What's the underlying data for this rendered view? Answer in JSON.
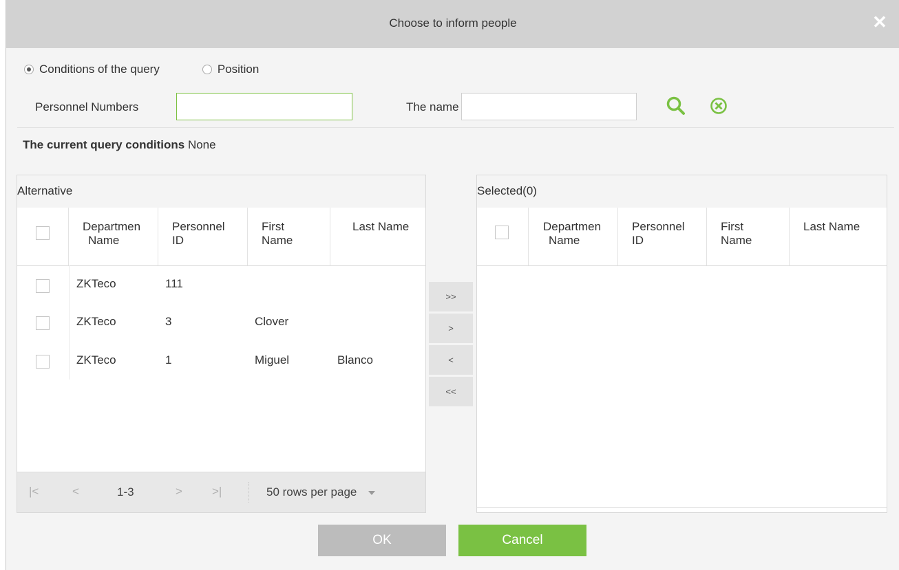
{
  "dialog": {
    "title": "Choose to inform people",
    "close_glyph": "✕"
  },
  "query_mode": {
    "options": [
      {
        "label": "Conditions of the query",
        "checked": true
      },
      {
        "label": "Position",
        "checked": false
      }
    ]
  },
  "search": {
    "personnel_numbers_label": "Personnel Numbers",
    "personnel_numbers_value": "",
    "name_label": "The name",
    "name_value": "",
    "search_icon": "search-icon",
    "clear_icon": "clear-circle-icon",
    "accent_color": "#7ac143"
  },
  "conditions": {
    "label": "The current query conditions",
    "value": "None"
  },
  "alternative": {
    "title": "Alternative",
    "columns": [
      [
        "Departmen",
        "Name"
      ],
      [
        "Personnel",
        "ID"
      ],
      [
        "First",
        "Name"
      ],
      [
        "Last Name"
      ]
    ],
    "rows": [
      {
        "department": "ZKTeco",
        "id": "111",
        "first": "",
        "last": ""
      },
      {
        "department": "ZKTeco",
        "id": "3",
        "first": "Clover",
        "last": ""
      },
      {
        "department": "ZKTeco",
        "id": "1",
        "first": "Miguel",
        "last": "Blanco"
      }
    ],
    "pager": {
      "first": "|<",
      "prev": "<",
      "range": "1-3",
      "next": ">",
      "last": ">|",
      "rows_per_page": "50 rows per page"
    }
  },
  "transfer": {
    "add_all": ">>",
    "add": ">",
    "remove": "<",
    "remove_all": "<<"
  },
  "selected": {
    "title": "Selected(0)",
    "columns": [
      [
        "Departmen",
        "Name"
      ],
      [
        "Personnel",
        "ID"
      ],
      [
        "First",
        "Name"
      ],
      [
        "Last Name"
      ]
    ]
  },
  "buttons": {
    "ok": "OK",
    "cancel": "Cancel"
  }
}
